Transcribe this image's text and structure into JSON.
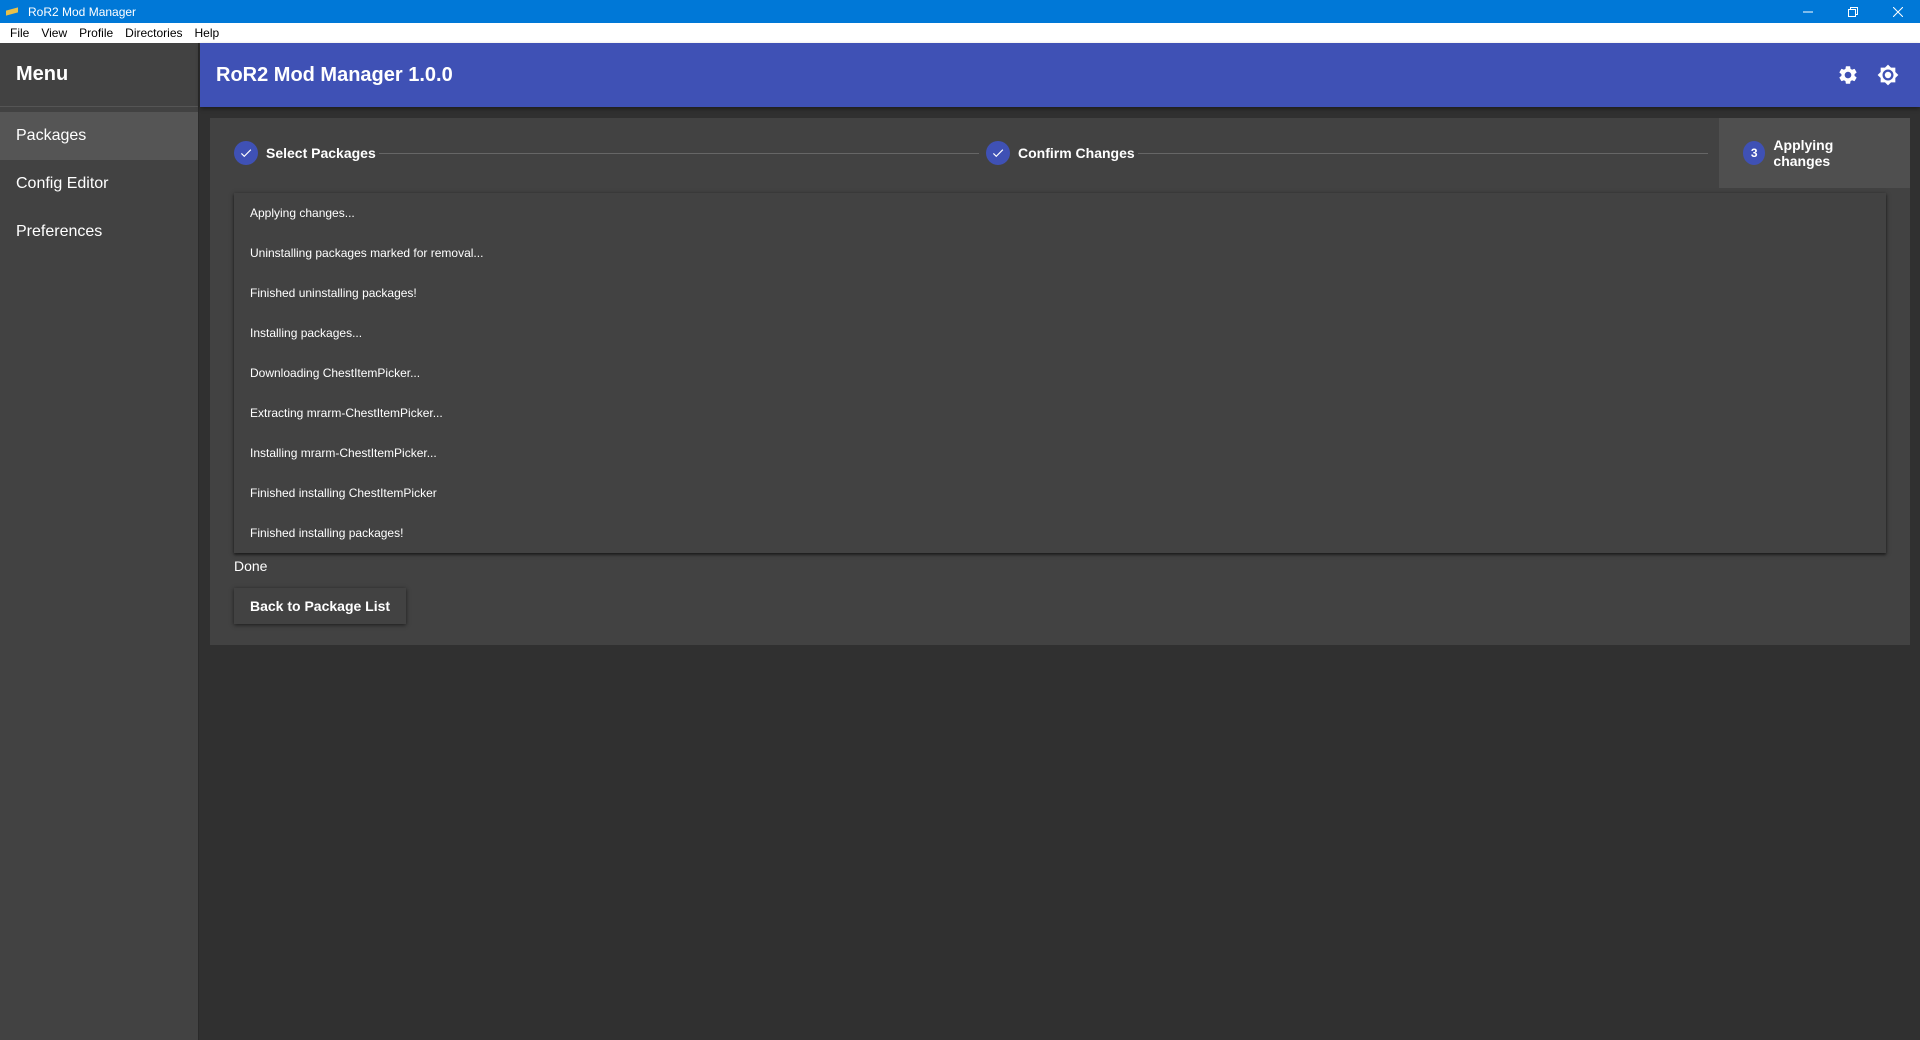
{
  "window": {
    "title": "RoR2 Mod Manager"
  },
  "menubar": {
    "items": [
      "File",
      "View",
      "Profile",
      "Directories",
      "Help"
    ]
  },
  "sidebar": {
    "heading": "Menu",
    "items": [
      {
        "label": "Packages",
        "active": true
      },
      {
        "label": "Config Editor",
        "active": false
      },
      {
        "label": "Preferences",
        "active": false
      }
    ]
  },
  "appbar": {
    "title": "RoR2 Mod Manager 1.0.0",
    "icons": [
      "settings-icon",
      "theme-icon"
    ]
  },
  "stepper": {
    "steps": [
      {
        "label": "Select Packages",
        "state": "completed",
        "icon": "check-icon"
      },
      {
        "label": "Confirm Changes",
        "state": "completed",
        "icon": "check-icon"
      },
      {
        "label": "Applying changes",
        "state": "active",
        "number": "3"
      }
    ]
  },
  "log": {
    "lines": [
      "Applying changes...",
      "Uninstalling packages marked for removal...",
      "Finished uninstalling packages!",
      "Installing packages...",
      "Downloading ChestItemPicker...",
      "Extracting mrarm-ChestItemPicker...",
      "Installing mrarm-ChestItemPicker...",
      "Finished installing ChestItemPicker",
      "Finished installing packages!"
    ]
  },
  "status": {
    "done_text": "Done"
  },
  "actions": {
    "back_label": "Back to Package List"
  },
  "colors": {
    "accent": "#3f51b5",
    "titlebar": "#0078d7",
    "surface": "#424242",
    "background": "#303030"
  }
}
